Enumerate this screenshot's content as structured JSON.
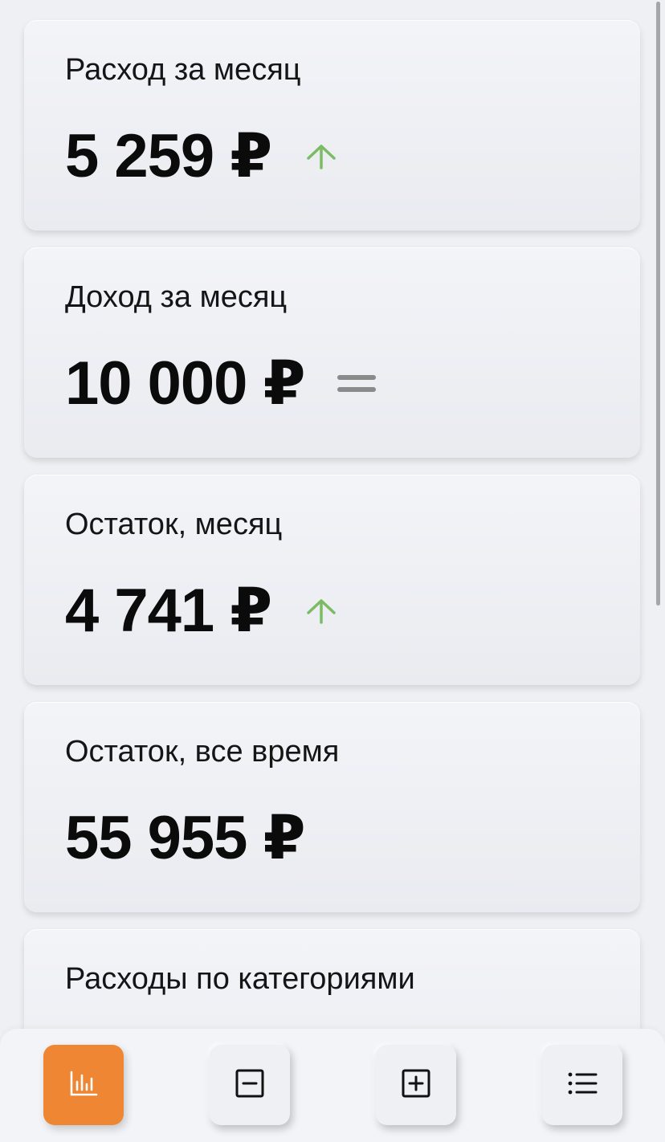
{
  "colors": {
    "accent": "#ee8633",
    "trend_up": "#7bbb62",
    "trend_flat": "#8a8a8a",
    "background": "#eff0f4"
  },
  "cards": [
    {
      "title": "Расход за месяц",
      "value": "5 259 ₽",
      "trend": "up"
    },
    {
      "title": "Доход за месяц",
      "value": "10 000 ₽",
      "trend": "equal"
    },
    {
      "title": "Остаток, месяц",
      "value": "4 741 ₽",
      "trend": "up"
    },
    {
      "title": "Остаток, все время",
      "value": "55 955 ₽",
      "trend": "none"
    },
    {
      "title": "Расходы по категориями"
    }
  ],
  "bottom_nav": [
    {
      "icon": "bar-chart-icon",
      "active": true
    },
    {
      "icon": "minus-square-icon",
      "active": false
    },
    {
      "icon": "plus-square-icon",
      "active": false
    },
    {
      "icon": "list-icon",
      "active": false
    }
  ]
}
